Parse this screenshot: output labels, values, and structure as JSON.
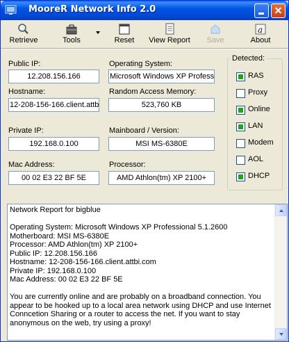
{
  "window": {
    "title": "MooreR Network Info 2.0"
  },
  "toolbar": {
    "retrieve": "Retrieve",
    "tools": "Tools",
    "reset": "Reset",
    "view_report": "View Report",
    "save": "Save",
    "about": "About"
  },
  "fields": {
    "public_ip": {
      "label": "Public IP:",
      "value": "12.208.156.166"
    },
    "operating_system": {
      "label": "Operating System:",
      "value": "Microsoft Windows XP Professi"
    },
    "hostname": {
      "label": "Hostname:",
      "value": "12-208-156-166.client.attb"
    },
    "ram": {
      "label": "Random Access Memory:",
      "value": "523,760 KB"
    },
    "private_ip": {
      "label": "Private IP:",
      "value": "192.168.0.100"
    },
    "mainboard": {
      "label": "Mainboard / Version:",
      "value": "MSI MS-6380E"
    },
    "mac": {
      "label": "Mac Address:",
      "value": "00 02 E3 22 BF 5E"
    },
    "processor": {
      "label": "Processor:",
      "value": "AMD Athlon(tm) XP 2100+"
    }
  },
  "detected": {
    "title": "Detected:",
    "items": [
      {
        "label": "RAS",
        "checked": true
      },
      {
        "label": "Proxy",
        "checked": false
      },
      {
        "label": "Online",
        "checked": true
      },
      {
        "label": "LAN",
        "checked": true
      },
      {
        "label": "Modem",
        "checked": false
      },
      {
        "label": "AOL",
        "checked": false
      },
      {
        "label": "DHCP",
        "checked": true
      }
    ]
  },
  "report": {
    "heading": "Network Report for bigblue",
    "lines": [
      "Operating System: Microsoft Windows XP Professional 5.1.2600",
      "Motherboard: MSI MS-6380E",
      "Processor: AMD Athlon(tm) XP 2100+",
      "Public IP: 12.208.156.166",
      "Hostname: 12-208-156-166.client.attbi.com",
      "Private IP: 192.168.0.100",
      "Mac Address: 00 02 E3 22 BF 5E"
    ],
    "summary": "You are currently online and are probably on a broadband connection. You appear to be hooked up to a local area network using DHCP and use Internet Conncetion Sharing or a router to access the net. If you want to stay anonymous on the web, try using a proxy!"
  },
  "colors": {
    "titlebar": "#0055e5",
    "check_mark": "#21a121",
    "field_border": "#7f9db9"
  }
}
